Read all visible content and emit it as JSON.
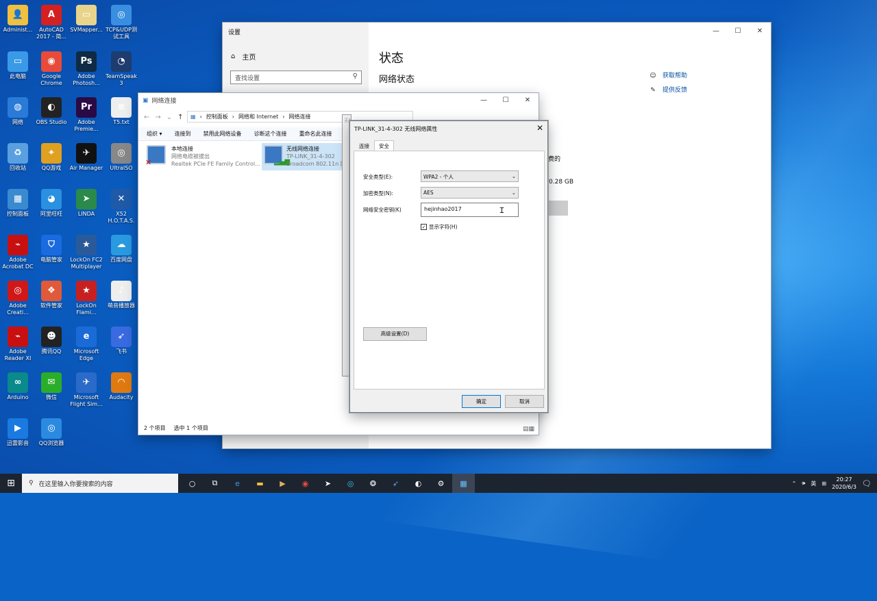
{
  "desktop": {
    "icons": [
      {
        "label": "Administ...",
        "glyph": "👤",
        "color": "#f0c040"
      },
      {
        "label": "AutoCAD 2017 - 简...",
        "glyph": "A",
        "color": "#d42020"
      },
      {
        "label": "SVMapper...",
        "glyph": "▭",
        "color": "#e8d48a"
      },
      {
        "label": "TCP&UDP测试工具",
        "glyph": "◎",
        "color": "#3a8ee0"
      },
      {
        "label": "此电脑",
        "glyph": "▭",
        "color": "#3a9ae8"
      },
      {
        "label": "Google Chrome",
        "glyph": "◉",
        "color": "#e84b3a"
      },
      {
        "label": "Adobe Photosh...",
        "glyph": "Ps",
        "color": "#0f2a44"
      },
      {
        "label": "TeamSpeak 3",
        "glyph": "◔",
        "color": "#1e3c6e"
      },
      {
        "label": "网络",
        "glyph": "◍",
        "color": "#2a7ad8"
      },
      {
        "label": "OBS Studio",
        "glyph": "◐",
        "color": "#222"
      },
      {
        "label": "Adobe Premie...",
        "glyph": "Pr",
        "color": "#2a0a44"
      },
      {
        "label": "T5.txt",
        "glyph": "≡",
        "color": "#eee"
      },
      {
        "label": "回收站",
        "glyph": "♻",
        "color": "#5aa0e0"
      },
      {
        "label": "QQ游戏",
        "glyph": "✦",
        "color": "#e0a020"
      },
      {
        "label": "Air Manager",
        "glyph": "✈",
        "color": "#111"
      },
      {
        "label": "UltraISO",
        "glyph": "◎",
        "color": "#888"
      },
      {
        "label": "控制面板",
        "glyph": "▦",
        "color": "#3a8ad0"
      },
      {
        "label": "阿里旺旺",
        "glyph": "◕",
        "color": "#2a90e0"
      },
      {
        "label": "LINDA",
        "glyph": "➤",
        "color": "#2a8a4a"
      },
      {
        "label": "X52 H.O.T.A.S.",
        "glyph": "✕",
        "color": "#1e5aa8"
      },
      {
        "label": "Adobe Acrobat DC",
        "glyph": "⌁",
        "color": "#c81010"
      },
      {
        "label": "电脑管家",
        "glyph": "⛉",
        "color": "#1a6ae0"
      },
      {
        "label": "LockOn FC2 Multiplayer",
        "glyph": "★",
        "color": "#2a5a9a"
      },
      {
        "label": "百度网盘",
        "glyph": "☁",
        "color": "#2a9ae0"
      },
      {
        "label": "Adobe Creati...",
        "glyph": "◎",
        "color": "#d01818"
      },
      {
        "label": "软件管家",
        "glyph": "❖",
        "color": "#e05a3a"
      },
      {
        "label": "LockOn Flami...",
        "glyph": "★",
        "color": "#c82020"
      },
      {
        "label": "萌音播放器",
        "glyph": "♪",
        "color": "#eee"
      },
      {
        "label": "Adobe Reader XI",
        "glyph": "⌁",
        "color": "#c81010"
      },
      {
        "label": "腾讯QQ",
        "glyph": "☻",
        "color": "#222"
      },
      {
        "label": "Microsoft Edge",
        "glyph": "e",
        "color": "#1a6ad8"
      },
      {
        "label": "飞书",
        "glyph": "➶",
        "color": "#3a6ae0"
      },
      {
        "label": "Arduino",
        "glyph": "∞",
        "color": "#0a8a8a"
      },
      {
        "label": "微信",
        "glyph": "✉",
        "color": "#2aae2a"
      },
      {
        "label": "Microsoft Flight Sim...",
        "glyph": "✈",
        "color": "#2a6ac8"
      },
      {
        "label": "Audacity",
        "glyph": "◠",
        "color": "#e07a10"
      },
      {
        "label": "迅雷影音",
        "glyph": "▶",
        "color": "#1a7ae0"
      },
      {
        "label": "QQ浏览器",
        "glyph": "◎",
        "color": "#2a8ae0"
      }
    ]
  },
  "settings": {
    "title": "设置",
    "home": "主页",
    "search_placeholder": "查找设置",
    "heading": "状态",
    "subheading": "网络状态",
    "help": "获取帮助",
    "feedback": "提供反馈",
    "frag1": "计费的",
    "frag2": "0.28 GB"
  },
  "netconn": {
    "title": "网络连接",
    "path": [
      "控制面板",
      "网络和 Internet",
      "网络连接"
    ],
    "toolbar": [
      "组织 ▾",
      "连接到",
      "禁用此网络设备",
      "诊断这个连接",
      "重命名此连接"
    ],
    "items": [
      {
        "name": "本地连接",
        "status": "网络电缆被拔出",
        "device": "Realtek PCIe FE Family Control..."
      },
      {
        "name": "无线网络连接",
        "status": "TP-LINK_31-4-302",
        "device": "Broadcom 802.11n 网..."
      }
    ],
    "status_count": "2 个项目",
    "status_selected": "选中 1 个项目",
    "ghost_title": "无线网络连接 状态"
  },
  "dialog": {
    "title": "TP-LINK_31-4-302 无线网络属性",
    "tab_connect": "连接",
    "tab_security": "安全",
    "sec_type_label": "安全类型(E):",
    "sec_type_value": "WPA2 - 个人",
    "enc_type_label": "加密类型(N):",
    "enc_type_value": "AES",
    "key_label": "网络安全密钥(K)",
    "key_value": "hejinhao2017",
    "show_chars": "显示字符(H)",
    "advanced": "高级设置(D)",
    "ok": "确定",
    "cancel": "取消"
  },
  "taskbar": {
    "search_placeholder": "在这里输入你要搜索的内容",
    "time": "20:27",
    "date": "2020/6/3",
    "ime": "英"
  }
}
